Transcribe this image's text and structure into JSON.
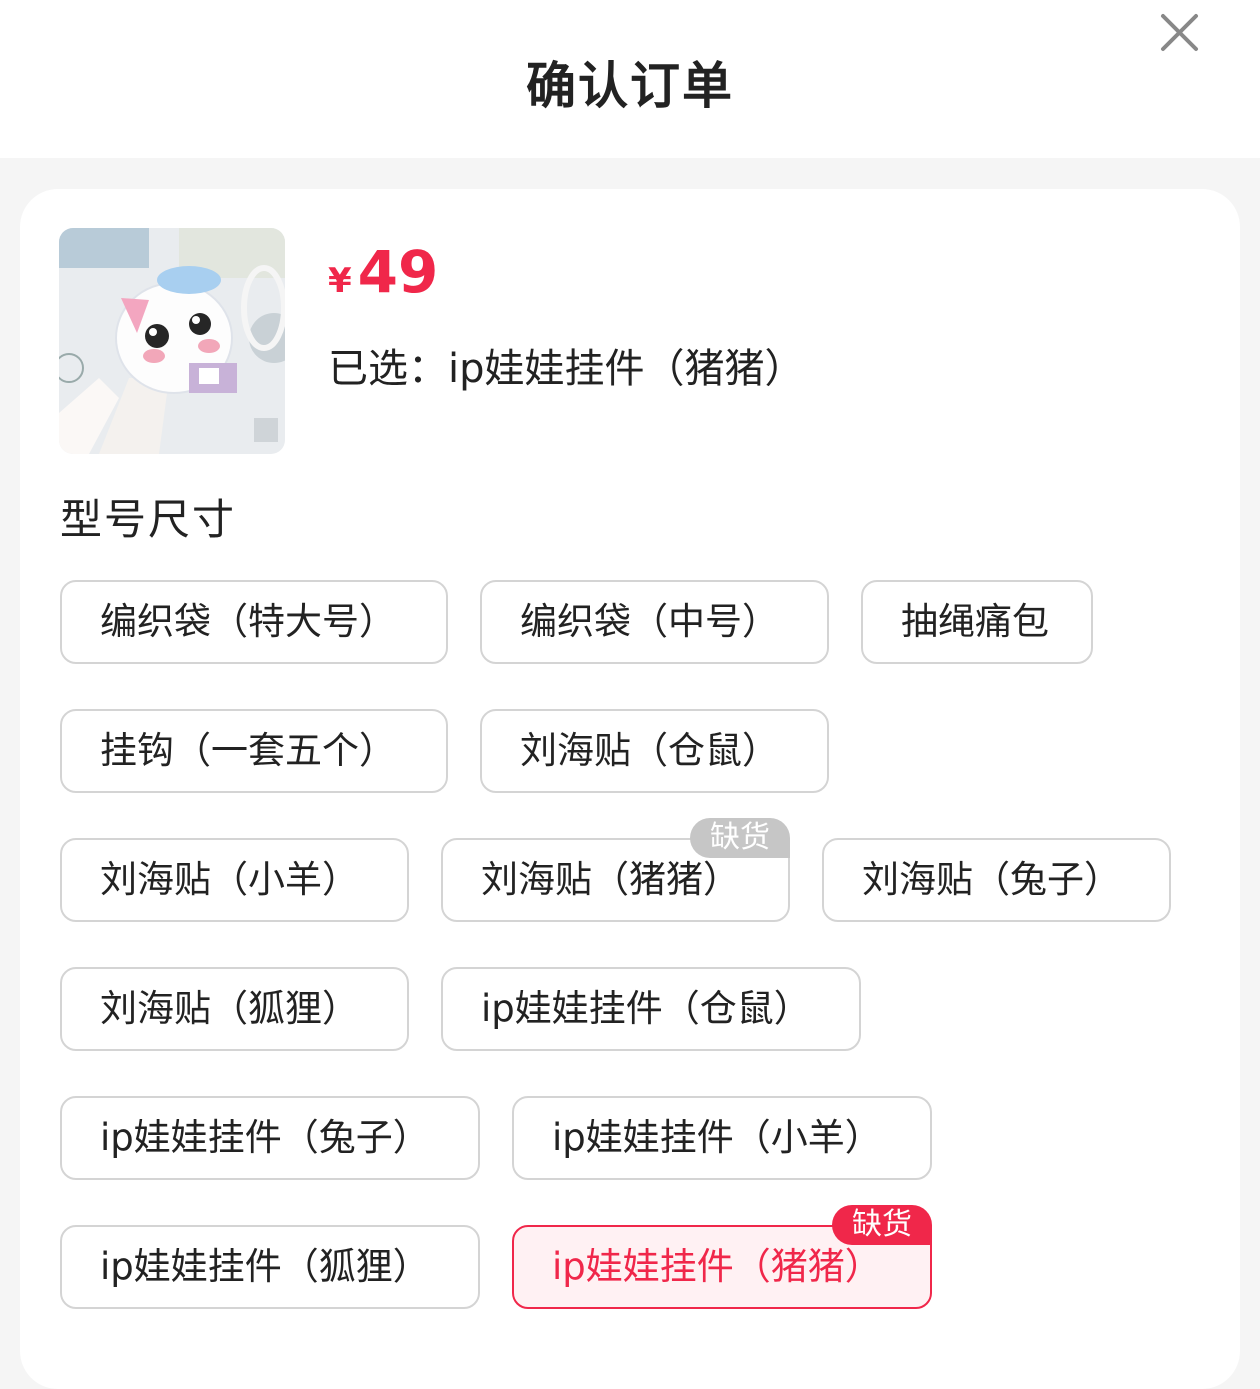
{
  "header": {
    "title": "确认订单"
  },
  "product": {
    "price_symbol": "¥",
    "price": "49",
    "selected_text": "已选：ip娃娃挂件（猪猪）"
  },
  "section": {
    "title": "型号尺寸"
  },
  "options": [
    {
      "label": "编织袋（特大号）"
    },
    {
      "label": "编织袋（中号）"
    },
    {
      "label": "抽绳痛包"
    },
    {
      "label": "挂钩（一套五个）"
    },
    {
      "label": "刘海贴（仓鼠）"
    },
    {
      "label": "刘海贴（小羊）"
    },
    {
      "label": "刘海贴（猪猪）",
      "badge": "缺货"
    },
    {
      "label": "刘海贴（兔子）"
    },
    {
      "label": "刘海贴（狐狸）"
    },
    {
      "label": "ip娃娃挂件（仓鼠）"
    },
    {
      "label": "ip娃娃挂件（兔子）"
    },
    {
      "label": "ip娃娃挂件（小羊）"
    },
    {
      "label": "ip娃娃挂件（狐狸）"
    },
    {
      "label": "ip娃娃挂件（猪猪）",
      "badge": "缺货",
      "selected": true
    }
  ],
  "colors": {
    "accent": "#f0274a",
    "border": "#d4d4d4",
    "badge_gray": "#c6c6c6"
  }
}
